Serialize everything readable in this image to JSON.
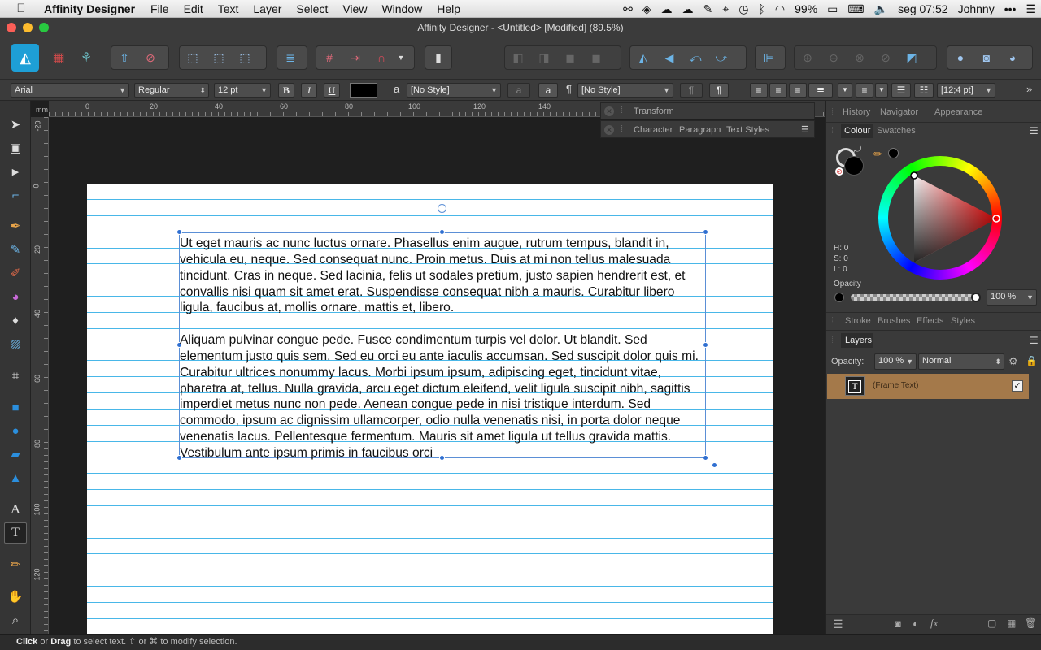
{
  "menubar": {
    "app_name": "Affinity Designer",
    "menus": [
      "File",
      "Edit",
      "Text",
      "Layer",
      "Select",
      "View",
      "Window",
      "Help"
    ],
    "battery": "99%",
    "clock": "seg 07:52",
    "user": "Johnny"
  },
  "window": {
    "title": "Affinity Designer - <Untitled> [Modified] (89.5%)"
  },
  "context": {
    "font": "Arial",
    "style": "Regular",
    "size": "12 pt",
    "bold": "B",
    "italic": "I",
    "underline": "U",
    "char_style": "[No Style]",
    "para_style": "[No Style]",
    "para_glyph": "¶",
    "char_glyph": "a",
    "spacing": "[12;4 pt]"
  },
  "ruler": {
    "unit": "mm",
    "h_labels": [
      "0",
      "20",
      "40",
      "60",
      "80",
      "100",
      "120",
      "140"
    ],
    "v_labels": [
      "-20",
      "0",
      "20",
      "40",
      "60",
      "80",
      "100",
      "120"
    ]
  },
  "document": {
    "paragraphs": [
      "Ut eget mauris ac nunc luctus ornare. Phasellus enim augue, rutrum tempus, blandit in, vehicula eu, neque. Sed consequat nunc. Proin metus. Duis at mi non tellus malesuada tincidunt. Cras in neque. Sed lacinia, felis ut sodales pretium, justo sapien hendrerit est, et convallis nisi quam sit amet erat. Suspendisse consequat nibh a mauris. Curabitur libero ligula, faucibus at, mollis ornare, mattis et, libero.",
      "Aliquam pulvinar congue pede. Fusce condimentum turpis vel dolor. Ut blandit. Sed elementum justo quis sem. Sed eu orci eu ante iaculis accumsan. Sed suscipit dolor quis mi. Curabitur ultrices nonummy lacus. Morbi ipsum ipsum, adipiscing eget, tincidunt vitae, pharetra at, tellus. Nulla gravida, arcu eget dictum eleifend, velit ligula suscipit nibh, sagittis imperdiet metus nunc non pede. Aenean congue pede in nisi tristique interdum. Sed commodo, ipsum ac dignissim ullamcorper, odio nulla venenatis nisi, in porta dolor neque venenatis lacus. Pellentesque fermentum. Mauris sit amet ligula ut tellus gravida mattis. Vestibulum ante ipsum primis in faucibus orci"
    ]
  },
  "float_panels": {
    "transform": "Transform",
    "text_tabs": [
      "Character",
      "Paragraph",
      "Text Styles"
    ]
  },
  "right_panel": {
    "top_tabs": [
      "History",
      "Navigator",
      "Appearance"
    ],
    "colour_tabs": [
      "Colour",
      "Swatches"
    ],
    "hsl": {
      "h": "H: 0",
      "s": "S: 0",
      "l": "L: 0"
    },
    "opacity_label": "Opacity",
    "opacity_value": "100 %",
    "mid_tabs": [
      "Stroke",
      "Brushes",
      "Effects",
      "Styles"
    ],
    "layers_tab": "Layers",
    "layers_opacity_label": "Opacity:",
    "layers_opacity_value": "100 %",
    "blend_mode": "Normal",
    "layer_name": "(Frame Text)",
    "colors": {
      "accent": "#a4794a",
      "hue_selected": "#ff1a1a"
    }
  },
  "status": {
    "click": "Click",
    "or1": " or ",
    "drag": "Drag",
    "rest": " to select text. ⇧ or ⌘ to modify selection."
  }
}
